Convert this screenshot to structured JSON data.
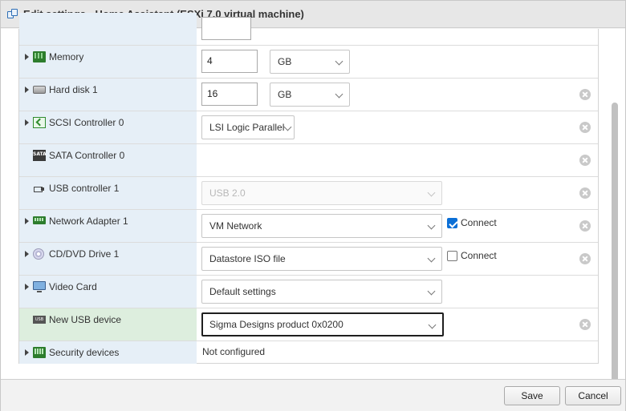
{
  "window": {
    "title": "Edit settings - Home Assistant (ESXi 7.0 virtual machine)",
    "icon": "edit-settings-icon"
  },
  "devices": [
    {
      "label": "Memory",
      "icon": "memory-icon",
      "value": "4",
      "unit": "GB"
    },
    {
      "label": "Hard disk 1",
      "icon": "hard-disk-icon",
      "value": "16",
      "unit": "GB"
    },
    {
      "label": "SCSI Controller 0",
      "icon": "scsi-controller-icon",
      "select": "LSI Logic Parallel"
    },
    {
      "label": "SATA Controller 0",
      "icon": "sata-controller-icon",
      "icon_text": "SATA"
    },
    {
      "label": "USB controller 1",
      "icon": "usb-icon",
      "select": "USB 2.0"
    },
    {
      "label": "Network Adapter 1",
      "icon": "network-adapter-icon",
      "select": "VM Network",
      "connect_label": "Connect",
      "connect_checked": true
    },
    {
      "label": "CD/DVD Drive 1",
      "icon": "cd-dvd-icon",
      "select": "Datastore ISO file",
      "connect_label": "Connect",
      "connect_checked": false
    },
    {
      "label": "Video Card",
      "icon": "video-card-icon",
      "select": "Default settings"
    },
    {
      "label": "New USB device",
      "icon": "usb-device-icon",
      "icon_text": "USB",
      "select": "Sigma Designs product 0x0200"
    },
    {
      "label": "Security devices",
      "icon": "security-devices-icon",
      "value_text": "Not configured"
    }
  ],
  "footer": {
    "save_label": "Save",
    "cancel_label": "Cancel"
  },
  "colors": {
    "device_column": "#e6eff7",
    "new_device_column": "#ddeede",
    "checkbox": "#0b6fd6"
  }
}
